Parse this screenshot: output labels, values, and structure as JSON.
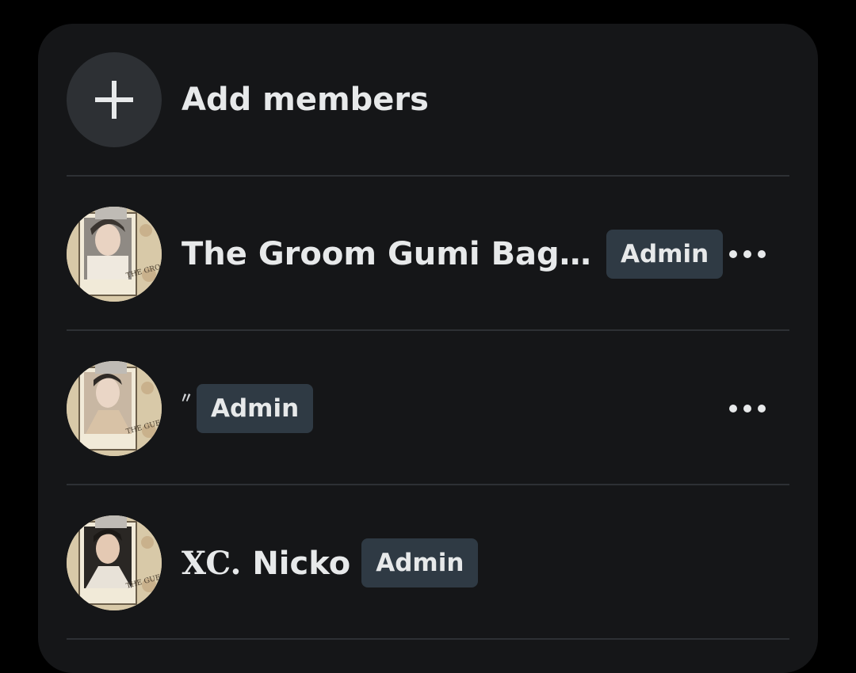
{
  "add_members": {
    "label": "Add members",
    "icon": "plus-icon"
  },
  "members": [
    {
      "name": "The Groom Gumi Bagj...",
      "badge": "Admin",
      "avatar_caption": "THE GROOM",
      "has_more_menu": true
    },
    {
      "name": "〃",
      "badge": "Admin",
      "avatar_caption": "THE GUEST",
      "has_more_menu": true
    },
    {
      "name_prefix": "XC.",
      "name": "Nicko",
      "badge": "Admin",
      "avatar_caption": "THE GUEST",
      "has_more_menu": false
    }
  ],
  "colors": {
    "background": "#000000",
    "panel": "#151618",
    "divider": "#2d3034",
    "badge_bg": "#2f3a44",
    "text": "#e7e9ea"
  }
}
